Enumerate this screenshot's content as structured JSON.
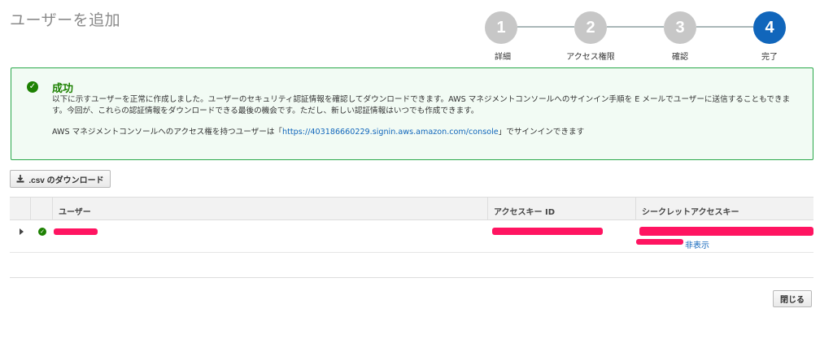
{
  "page": {
    "title": "ユーザーを追加"
  },
  "steps": [
    {
      "number": "1",
      "label": "詳細"
    },
    {
      "number": "2",
      "label": "アクセス権限"
    },
    {
      "number": "3",
      "label": "確認"
    },
    {
      "number": "4",
      "label": "完了"
    }
  ],
  "alert": {
    "title": "成功",
    "body": "以下に示すユーザーを正常に作成しました。ユーザーのセキュリティ認証情報を確認してダウンロードできます。AWS マネジメントコンソールへのサインイン手順を E メールでユーザーに送信することもできます。今回が、これらの認証情報をダウンロードできる最後の機会です。ただし、新しい認証情報はいつでも作成できます。",
    "url_prefix": "AWS マネジメントコンソールへのアクセス権を持つユーザーは「",
    "url": "https://403186660229.signin.aws.amazon.com/console",
    "url_suffix": "」でサインインできます"
  },
  "download_button": {
    "label": ".csv のダウンロード"
  },
  "table": {
    "headers": {
      "user": "ユーザー",
      "access_key": "アクセスキー ID",
      "secret_key": "シークレットアクセスキー"
    },
    "rows": [
      {
        "hide_link": "非表示"
      }
    ]
  },
  "close_button": {
    "label": "閉じる"
  },
  "colors": {
    "accent": "#1166bb",
    "success": "#1d8102",
    "redaction": "#ff1461"
  },
  "icons": {
    "success": "check-circle-icon",
    "download": "download-icon",
    "expand": "caret-right-icon"
  }
}
